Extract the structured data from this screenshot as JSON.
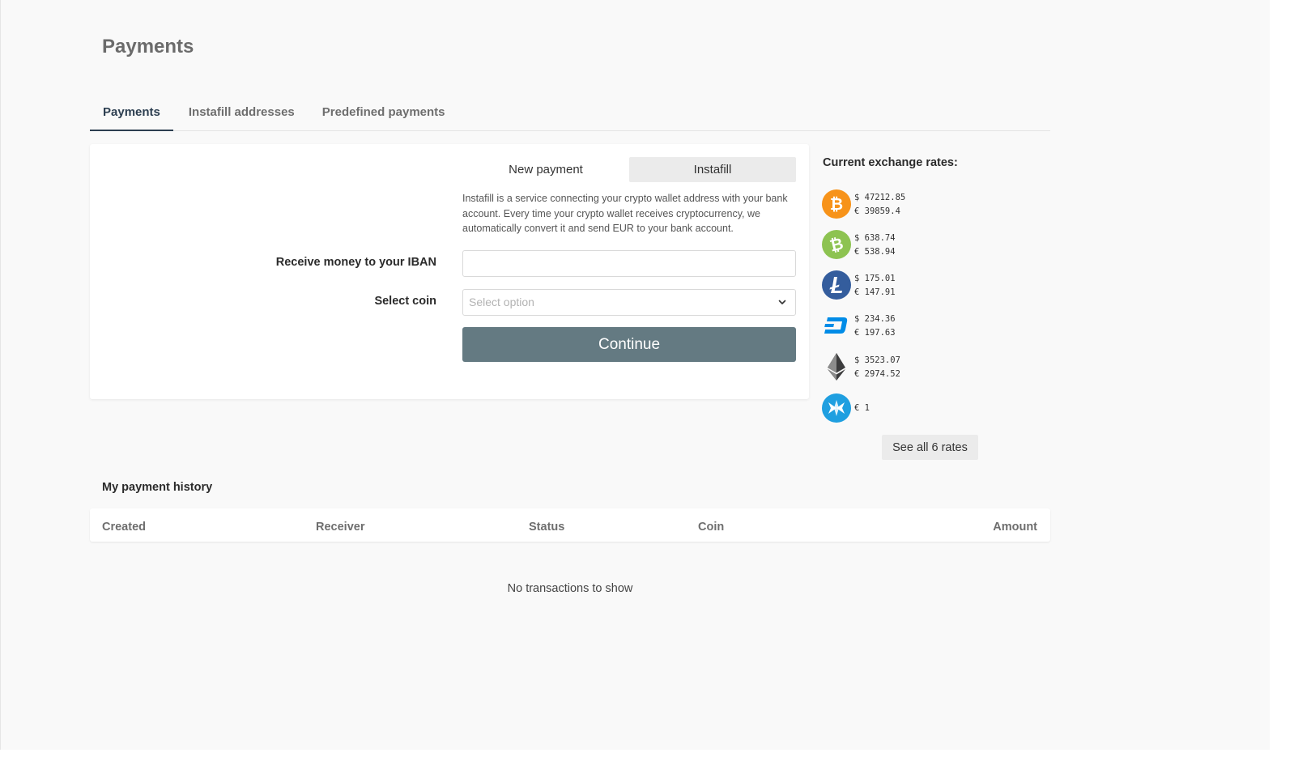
{
  "page": {
    "title": "Payments"
  },
  "tabs": [
    {
      "label": "Payments",
      "active": true
    },
    {
      "label": "Instafill addresses",
      "active": false
    },
    {
      "label": "Predefined payments",
      "active": false
    }
  ],
  "form": {
    "mode_new": "New payment",
    "mode_instafill": "Instafill",
    "selected_mode": "Instafill",
    "description": "Instafill is a service connecting your crypto wallet address with your bank account. Every time your crypto wallet receives cryptocurrency, we automatically convert it and send EUR to your bank account.",
    "iban_label": "Receive money to your IBAN",
    "iban_value": "",
    "coin_label": "Select coin",
    "coin_placeholder": "Select option",
    "continue_label": "Continue"
  },
  "rates": {
    "title": "Current exchange rates:",
    "items": [
      {
        "icon": "bitcoin-icon",
        "color": "#f7931a",
        "usd": "$ 47212.85",
        "eur": "€ 39859.4"
      },
      {
        "icon": "bitcoin-cash-icon",
        "color": "#8dc351",
        "usd": "$ 638.74",
        "eur": "€ 538.94"
      },
      {
        "icon": "litecoin-icon",
        "color": "#345d9d",
        "usd": "$ 175.01",
        "eur": "€ 147.91"
      },
      {
        "icon": "dash-icon",
        "color": "#008ce7",
        "usd": "$ 234.36",
        "eur": "€ 197.63"
      },
      {
        "icon": "ethereum-icon",
        "color": "#3c3c3d",
        "usd": "$ 3523.07",
        "eur": "€ 2974.52"
      },
      {
        "icon": "stablecoin-icon",
        "color": "#1f9fe0",
        "eur": "€ 1"
      }
    ],
    "see_all_label": "See all 6 rates"
  },
  "history": {
    "title": "My payment history",
    "columns": [
      "Created",
      "Receiver",
      "Status",
      "Coin",
      "Amount"
    ],
    "empty_text": "No transactions to show"
  }
}
